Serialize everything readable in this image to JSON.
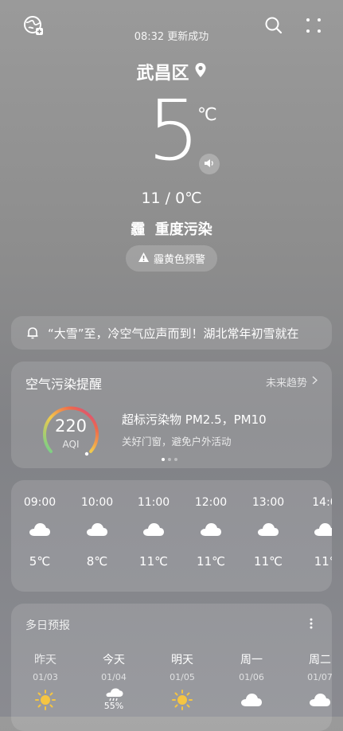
{
  "header": {
    "status": "08:32 更新成功",
    "city": "武昌区"
  },
  "current": {
    "temp": "5",
    "unit": "℃",
    "range": "11 / 0℃",
    "condition": "霾  重度污染",
    "warning": "霾黄色预警"
  },
  "notice": {
    "text": "“大雪”至，冷空气应声而到！湖北常年初雪就在"
  },
  "air": {
    "title": "空气污染提醒",
    "trend_label": "未来趋势",
    "aqi_value": "220",
    "aqi_label": "AQI",
    "aqi_fraction": 0.44,
    "pollutant": "超标污染物 PM2.5，PM10",
    "advice": "关好门窗，避免户外活动"
  },
  "hourly": [
    {
      "time": "09:00",
      "temp": "5℃",
      "icon": "cloud-icon"
    },
    {
      "time": "10:00",
      "temp": "8℃",
      "icon": "cloud-icon"
    },
    {
      "time": "11:00",
      "temp": "11℃",
      "icon": "cloud-icon"
    },
    {
      "time": "12:00",
      "temp": "11℃",
      "icon": "cloud-icon"
    },
    {
      "time": "13:00",
      "temp": "11℃",
      "icon": "cloud-icon"
    },
    {
      "time": "14:0",
      "temp": "11°",
      "icon": "cloud-icon"
    }
  ],
  "forecast": {
    "title": "多日预报",
    "days": [
      {
        "name": "昨天",
        "date": "01/03",
        "icon": "sun-icon",
        "precip": ""
      },
      {
        "name": "今天",
        "date": "01/04",
        "icon": "rain-cloud-icon",
        "precip": "55%"
      },
      {
        "name": "明天",
        "date": "01/05",
        "icon": "sun-icon",
        "precip": ""
      },
      {
        "name": "周一",
        "date": "01/06",
        "icon": "cloud-icon",
        "precip": ""
      },
      {
        "name": "周二",
        "date": "01/07",
        "icon": "cloud-icon",
        "precip": ""
      }
    ]
  },
  "colors": {
    "accent_gauge_start": "#6fd08c",
    "accent_gauge_mid": "#f2c94c",
    "accent_gauge_end": "#c63fa0",
    "sun": "#f5c542"
  }
}
